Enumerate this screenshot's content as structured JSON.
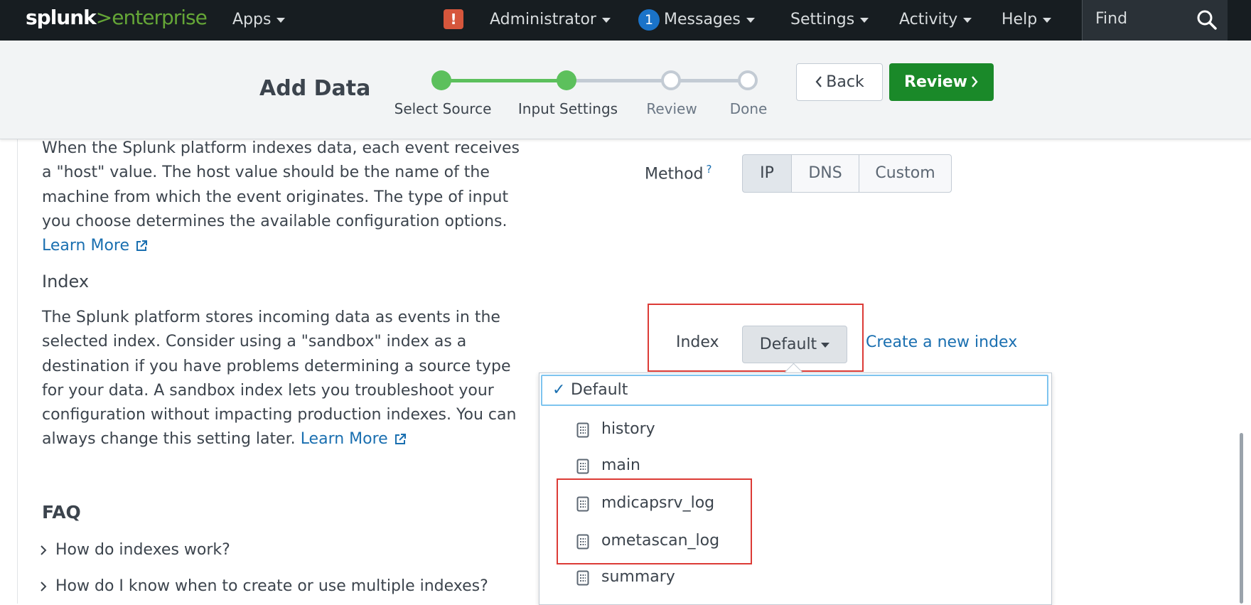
{
  "topbar": {
    "logo_word": "splunk",
    "logo_gt": ">",
    "logo_product": "enterprise",
    "apps": "Apps",
    "alert_mark": "!",
    "administrator": "Administrator",
    "messages_count": "1",
    "messages": "Messages",
    "settings": "Settings",
    "activity": "Activity",
    "help": "Help",
    "find_placeholder": "Find"
  },
  "header": {
    "title": "Add Data",
    "steps": [
      {
        "label": "Select Source",
        "state": "done"
      },
      {
        "label": "Input Settings",
        "state": "current"
      },
      {
        "label": "Review",
        "state": "todo"
      },
      {
        "label": "Done",
        "state": "todo"
      }
    ],
    "back_label": "Back",
    "review_label": "Review"
  },
  "host": {
    "description": "When the Splunk platform indexes data, each event receives a \"host\" value. The host value should be the name of the machine from which the event originates. The type of input you choose determines the available configuration options.",
    "learn_more": "Learn More",
    "method_label": "Method",
    "method_help": "?",
    "methods": [
      "IP",
      "DNS",
      "Custom"
    ],
    "selected_method": "IP"
  },
  "index": {
    "heading": "Index",
    "description": "The Splunk platform stores incoming data as events in the selected index. Consider using a \"sandbox\" index as a destination if you have problems determining a source type for your data. A sandbox index lets you troubleshoot your configuration without impacting production indexes. You can always change this setting later.",
    "learn_more": "Learn More",
    "field_label": "Index",
    "selected": "Default",
    "create_link": "Create a new index",
    "options": [
      "Default",
      "history",
      "main",
      "mdicapsrv_log",
      "ometascan_log",
      "summary"
    ]
  },
  "faq": {
    "heading": "FAQ",
    "items": [
      "How do indexes work?",
      "How do I know when to create or use multiple indexes?"
    ]
  },
  "colors": {
    "topbar_bg": "#171d21",
    "accent_green": "#5cc05c",
    "review_button": "#1a8929",
    "link_blue": "#1a6fb0",
    "highlight_red": "#dc3b36"
  }
}
